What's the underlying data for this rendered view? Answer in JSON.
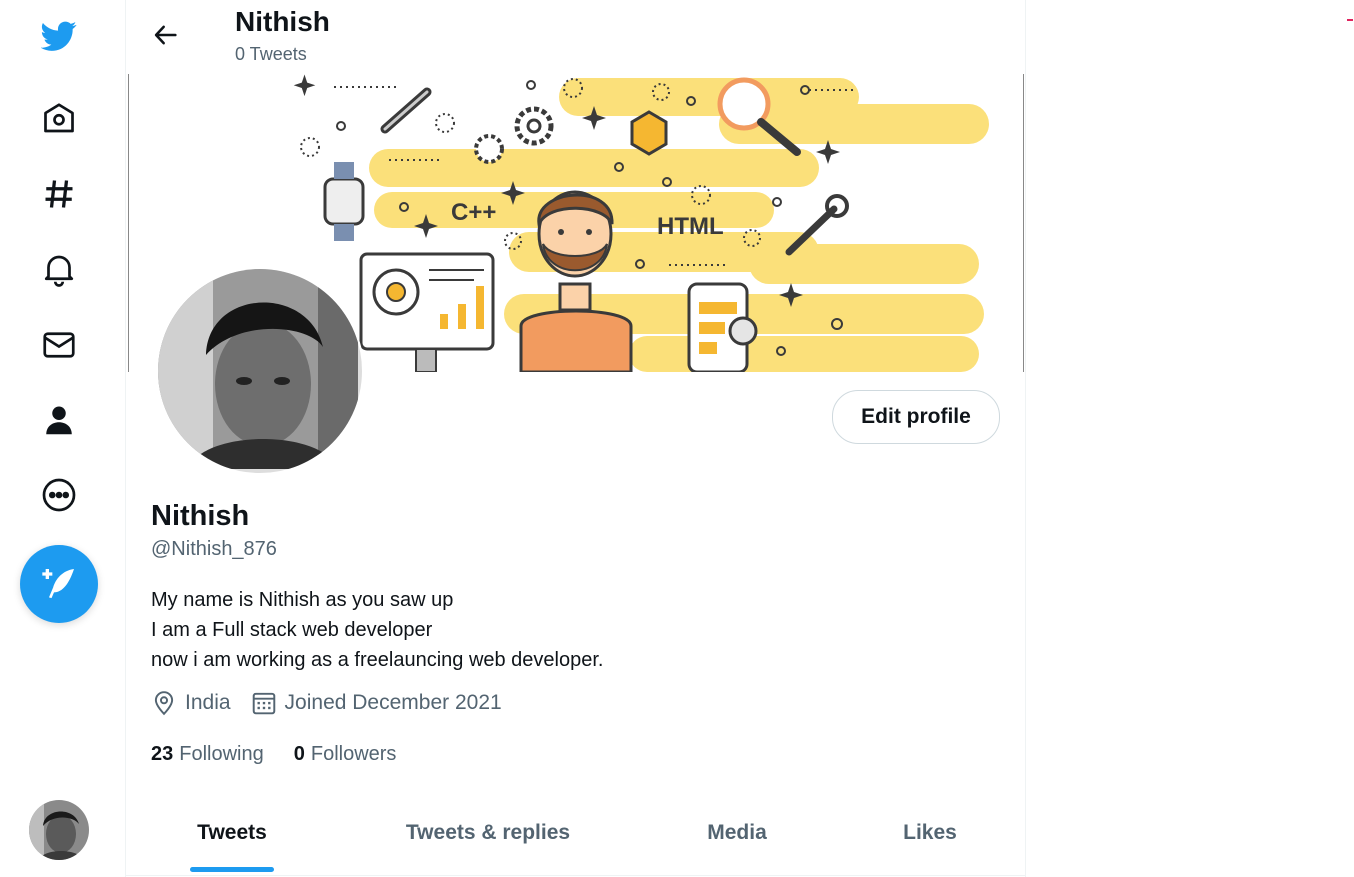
{
  "icons": {
    "logo": "twitter-bird-icon",
    "home": "home-icon",
    "explore": "hashtag-icon",
    "notifications": "bell-icon",
    "messages": "envelope-icon",
    "profile": "person-icon",
    "more": "more-circle-icon",
    "compose": "feather-plus-icon",
    "back": "arrow-left-icon",
    "location": "location-pin-icon",
    "joined": "calendar-icon"
  },
  "colors": {
    "accent": "#1d9bf0",
    "text": "#0f1419",
    "secondary": "#536471"
  },
  "header": {
    "title": "Nithish",
    "tweet_count": "0 Tweets"
  },
  "banner": {
    "tags": [
      "C++",
      "HTML"
    ]
  },
  "profile": {
    "edit_label": "Edit profile",
    "name": "Nithish",
    "handle": "@Nithish_876",
    "bio": "My name is Nithish as you saw up\nI am  a Full stack web developer\nnow i am working as a freelauncing web developer.",
    "location": "India",
    "joined": "Joined December 2021",
    "following_count": "23",
    "following_label": "Following",
    "followers_count": "0",
    "followers_label": "Followers"
  },
  "tabs": [
    {
      "label": "Tweets",
      "active": true
    },
    {
      "label": "Tweets & replies",
      "active": false
    },
    {
      "label": "Media",
      "active": false
    },
    {
      "label": "Likes",
      "active": false
    }
  ]
}
